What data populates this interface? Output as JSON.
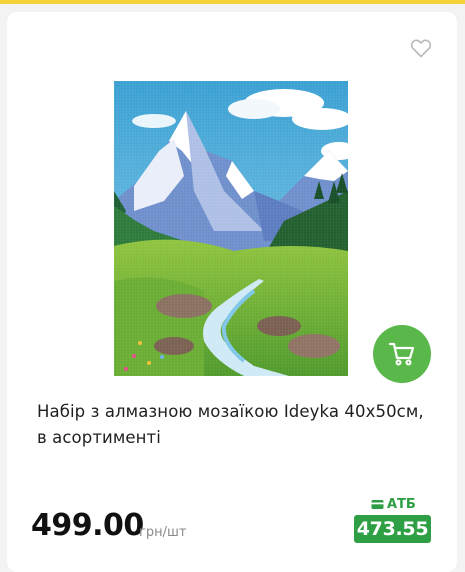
{
  "product": {
    "title": "Набір з алмазною мозаїкою Ideyka 40х50см, в асортименті",
    "price": "499.00",
    "unit": "грн/шт",
    "promo_store": "АТБ",
    "promo_price": "473.55",
    "image_description": "diamond mosaic mountain landscape",
    "favorite_icon": "heart-outline-icon",
    "cart_icon": "cart-icon"
  },
  "colors": {
    "top_bar": "#f6d33a",
    "cart_button": "#5ab84a",
    "promo_green": "#2e9f44"
  }
}
